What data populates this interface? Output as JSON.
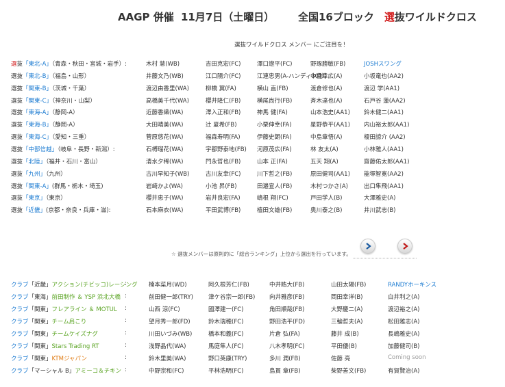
{
  "header": {
    "title_part1": "AAGP 併催",
    "title_part2": "11月7日（土曜日）",
    "title_part3_prefix": "全国16ブロック",
    "title_part3_red": "選",
    "title_part3_suffix": "抜ワイルドクロス"
  },
  "intro": "選抜ワイルドクロス メンバー にご注目を！",
  "selection_rows": [
    {
      "sen": "選",
      "ba": "抜",
      "region": "「東北-A」",
      "area": "（青森・秋田・宮城・岩手）:",
      "m1": "木村 慧(WB)",
      "m2": "吉田克宏(FC)",
      "m3": "澤口遼平(FC)",
      "m4": "野琢勝敏(FB)",
      "m5": "JOSHスワング"
    },
    {
      "sen": "選",
      "ba": "抜",
      "region": "「東北-B」",
      "area": "（福島・山形）",
      "m1": "井藤文乃(WB)",
      "m2": "江口陽介(FC)",
      "m3": "江連忠男(A-ハンディ30秒)",
      "m4": "中島幸広(A)",
      "m5": "小坂竜也(AA2)"
    },
    {
      "sen": "選",
      "ba": "抜",
      "region": "「関東-B」",
      "area": "（茨城・千葉）",
      "m1": "渡辺由香里(WA)",
      "m2": "柳橋 翼(FA)",
      "m3": "横山 直(FB)",
      "m4": "渡倉修也(A)",
      "m5": "渡辺 学(AA1)"
    },
    {
      "sen": "選",
      "ba": "抜",
      "region": "「関東-C」",
      "area": "（神奈川・山梨）",
      "m1": "高橋美千代(WA)",
      "m2": "櫻井隆仁(FB)",
      "m3": "横尾尚行(FB)",
      "m4": "斉木達也(A)",
      "m5": "石戸谷 蓮(AA2)"
    },
    {
      "sen": "選",
      "ba": "抜",
      "region": "「東海-A」",
      "area": "（静岡-A）",
      "m1": "近藤香織(WA)",
      "m2": "澤入正和(FB)",
      "m3": "神馬 健(FA)",
      "m4": "山本浩史(AA1)",
      "m5": "鈴木健二(AA1)"
    },
    {
      "sen": "選",
      "ba": "抜",
      "region": "「東海-B」",
      "area": "（静岡-A）",
      "m1": "大田晴美(WA)",
      "m2": "辻 夏希(FB)",
      "m3": "小栗伸幸(FA)",
      "m4": "星野恭平(AA1)",
      "m5": "内山裕太郎(AA1)"
    },
    {
      "sen": "選",
      "ba": "抜",
      "region": "「東海-C」",
      "area": "（愛知・三重）",
      "m1": "菅原悠花(WA)",
      "m2": "福森寿明(FA)",
      "m3": "伊藤史朗(FA)",
      "m4": "中島章悟(A)",
      "m5": "榎田諒介 (AA2)"
    },
    {
      "sen": "選",
      "ba": "抜",
      "region": "「中部信越」",
      "area": "（岐阜・長野・新潟）:",
      "m1": "石榑瑠花(WA)",
      "m2": "宇都野泰地(FB)",
      "m3": "河原茂広(FA)",
      "m4": "林 友太(A)",
      "m5": "小林雅人(AA1)"
    },
    {
      "sen": "選",
      "ba": "抜",
      "region": "「北陸」",
      "area": "（福井・石川・富山）",
      "m1": "清水夕稀(WA)",
      "m2": "門永哲也(FB)",
      "m3": "山本 正(FA)",
      "m4": "五天 翔(A)",
      "m5": "齋藤佑太郎(AA1)"
    },
    {
      "sen": "選",
      "ba": "抜",
      "region": "「九州」",
      "area": "（九州）",
      "m1": "古川早知子(WB)",
      "m2": "古川友幸(FC)",
      "m3": "川下哲之(FB)",
      "m4": "原田健司(AA1)",
      "m5": "能塚智寛(AA2)"
    },
    {
      "sen": "選",
      "ba": "抜",
      "region": "「関東-A」",
      "area": "(群馬・栃木・埼玉)",
      "m1": "岩崎かよ(WA)",
      "m2": "小池 昇(FB)",
      "m3": "田邉宣人(FB)",
      "m4": "木村つかさ(A)",
      "m5": "出口隼飛(AA1)"
    },
    {
      "sen": "選",
      "ba": "抜",
      "region": "「東京」",
      "area": "（東京）",
      "m1": "櫻井恵子(WA)",
      "m2": "岩井良宏(FA)",
      "m3": "嶋根 翔(FC)",
      "m4": "戸田学人(B)",
      "m5": "大澤雅史(A)"
    },
    {
      "sen": "選",
      "ba": "抜",
      "region": "「近畿」",
      "area": "(京都・奈良・兵庫・滋):",
      "m1": "石本麻衣(WA)",
      "m2": "平田武博(FB)",
      "m3": "植田文雄(FB)",
      "m4": "奥川泰之(B)",
      "m5": "井川武志(B)"
    }
  ],
  "note": "☆ 選抜メンバーは原則的に「総合ランキング」上位から選出を行っています。",
  "nav": {
    "prev_icon": "chevron-right-icon",
    "next_icon": "chevron-right-icon"
  },
  "club_rows": [
    {
      "club": "クラブ",
      "region": "「近畿」",
      "team": "アクション(チビッコ)レーシング",
      "colon": ":",
      "m1": "楠本菜月(WD)",
      "m2": "阿久根芳仁(FB)",
      "m3": "中井皓大(FB)",
      "m4": "山田太陽(FB)",
      "m5": "RANDYホーキンス"
    },
    {
      "club": "クラブ",
      "region": "「東海」",
      "team": "前田制作 ＆ YSP 浜北大橋",
      "colon": ":",
      "m1": "前田健一郎(TRY)",
      "m2": "津ケ谷宗一郎(FB)",
      "m3": "向井雅彦(FB)",
      "m4": "岡田幸洋(B)",
      "m5": "白井利之(A)"
    },
    {
      "club": "クラブ",
      "region": "「関東」",
      "team": "フレアライン ＆ MOTUL",
      "colon": ":",
      "m1": "山西 涼(FC)",
      "m2": "國澤建一(FC)",
      "m3": "角田順哉(FB)",
      "m4": "大野慶二(A)",
      "m5": "渡辺裕之(A)"
    },
    {
      "club": "クラブ",
      "region": "「関東」",
      "team": "チーム肩こり",
      "colon": ":",
      "m1": "望月秀一郎(FD)",
      "m2": "鈴木瑞穂(FC)",
      "m3": "野田浩平(FD)",
      "m4": "三輪哲夫(A)",
      "m5": "松田雅志(A)"
    },
    {
      "club": "クラブ",
      "region": "「関東」",
      "team": "チームケイズナグ",
      "colon": ":",
      "m1": "川田いづみ(WB)",
      "m2": "橋本和義(FC)",
      "m3": "片倉 弘(FA)",
      "m4": "藤井 成(B)",
      "m5": "長嶋雅史(A)"
    },
    {
      "club": "クラブ",
      "region": "「関東」",
      "team": "Stars Trading RT",
      "colon": ":",
      "m1": "浅野晶代(WA)",
      "m2": "馬庭隼人(FC)",
      "m3": "八木孝明(FC)",
      "m4": "平田優(B)",
      "m5": "加藤健司(B)"
    },
    {
      "club": "クラブ",
      "region": "「関東」",
      "team": "KTMジャパン",
      "colon": ":",
      "m1": "鈴木里美(WA)",
      "m2": "野口英康(TRY)",
      "m3": "多川 潤(FB)",
      "m4": "佐藤 亮",
      "m5": "Coming soon"
    },
    {
      "club": "クラブ",
      "region": "「マーシャル B」",
      "team": "アミーコ＆チキン",
      "colon": ":",
      "m1": "中野宗和(FC)",
      "m2": "平林浩明(FC)",
      "m3": "島貫 章(FB)",
      "m4": "柴野善文(FB)",
      "m5": "有賀賢治(A)"
    }
  ],
  "colors": {
    "red": "#d11a1a",
    "blue": "#1a7ad1",
    "green": "#58a320",
    "orange": "#e07b13"
  }
}
